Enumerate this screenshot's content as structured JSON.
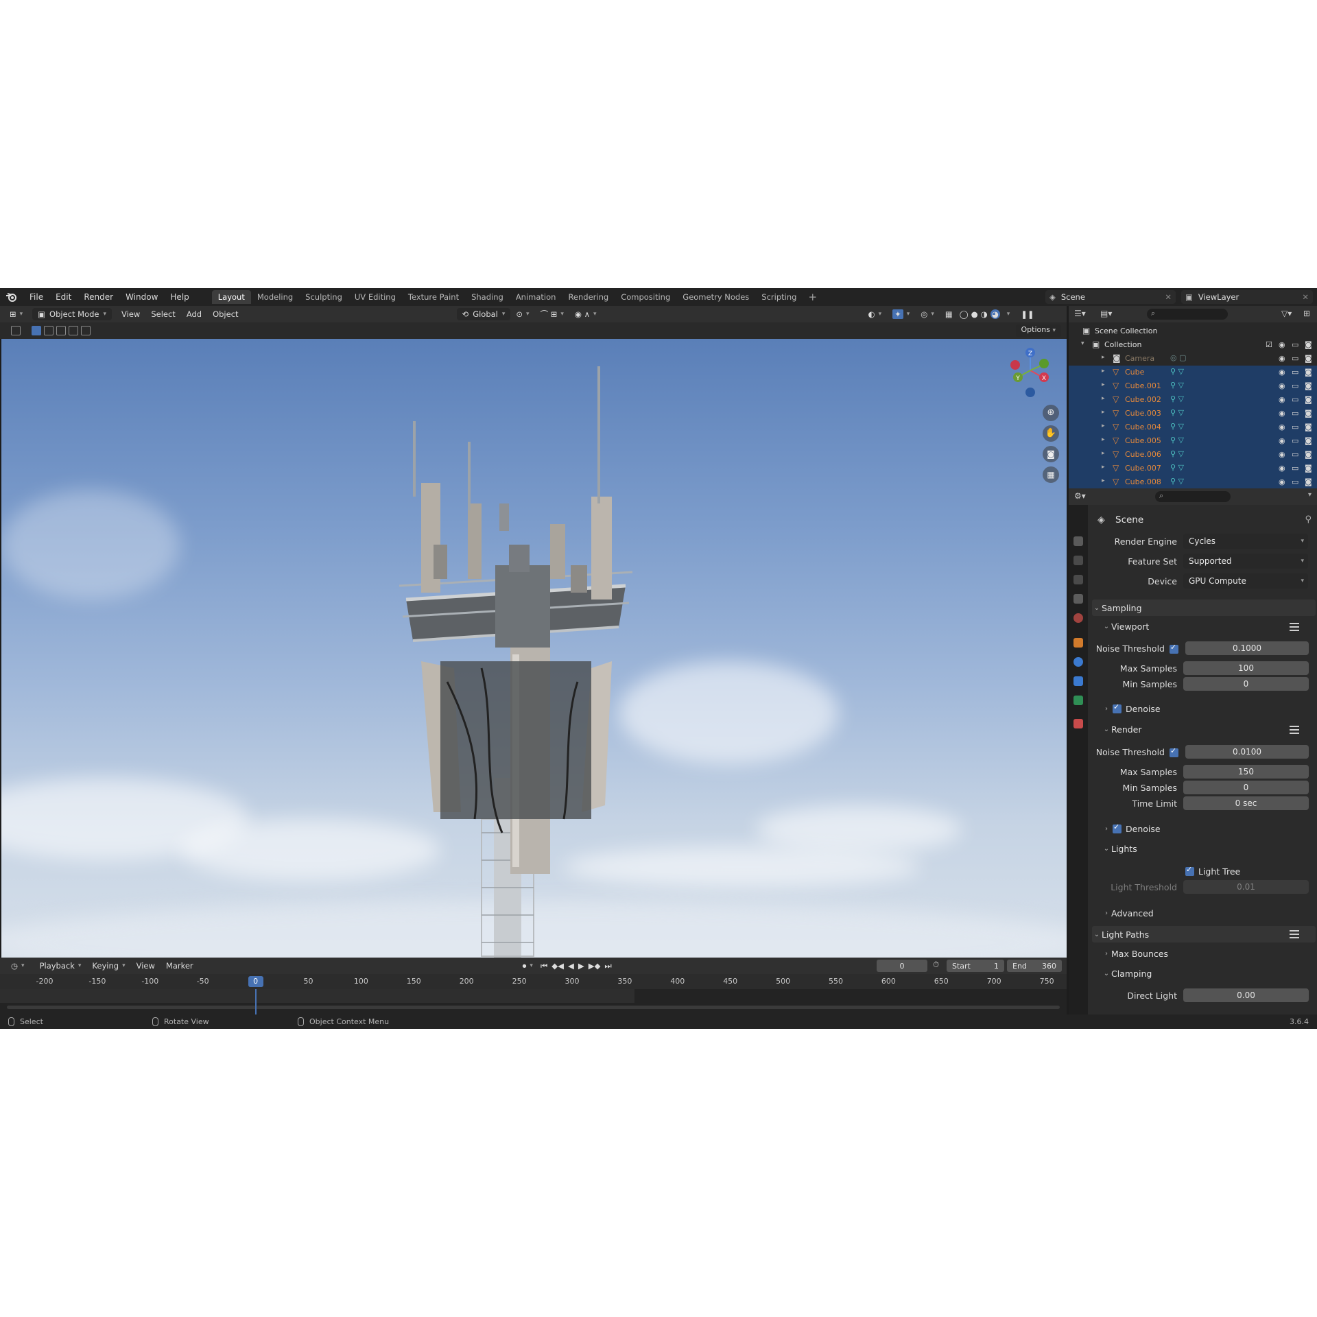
{
  "menu": [
    "File",
    "Edit",
    "Render",
    "Window",
    "Help"
  ],
  "workspaces": [
    "Layout",
    "Modeling",
    "Sculpting",
    "UV Editing",
    "Texture Paint",
    "Shading",
    "Animation",
    "Rendering",
    "Compositing",
    "Geometry Nodes",
    "Scripting"
  ],
  "active_workspace": "Layout",
  "scene_name": "Scene",
  "view_layer": "ViewLayer",
  "header": {
    "mode": "Object Mode",
    "view": "View",
    "select": "Select",
    "add": "Add",
    "object": "Object",
    "orientation": "Global"
  },
  "options_label": "Options",
  "outliner": {
    "scene_collection": "Scene Collection",
    "collection": "Collection",
    "objects": [
      "Camera",
      "Cube",
      "Cube.001",
      "Cube.002",
      "Cube.003",
      "Cube.004",
      "Cube.005",
      "Cube.006",
      "Cube.007",
      "Cube.008"
    ]
  },
  "properties": {
    "title": "Scene",
    "render_engine_label": "Render Engine",
    "render_engine": "Cycles",
    "feature_set_label": "Feature Set",
    "feature_set": "Supported",
    "device_label": "Device",
    "device": "GPU Compute",
    "sampling": "Sampling",
    "viewport": "Viewport",
    "noise_threshold_label": "Noise Threshold",
    "viewport_noise_threshold": "0.1000",
    "max_samples_label": "Max Samples",
    "viewport_max_samples": "100",
    "min_samples_label": "Min Samples",
    "viewport_min_samples": "0",
    "denoise": "Denoise",
    "render": "Render",
    "render_noise_threshold": "0.0100",
    "render_max_samples": "150",
    "render_min_samples": "0",
    "time_limit_label": "Time Limit",
    "time_limit": "0 sec",
    "lights": "Lights",
    "light_tree": "Light Tree",
    "light_threshold_label": "Light Threshold",
    "light_threshold": "0.01",
    "advanced": "Advanced",
    "light_paths": "Light Paths",
    "max_bounces": "Max Bounces",
    "clamping": "Clamping",
    "direct_light_label": "Direct Light",
    "direct_light": "0.00"
  },
  "timeline": {
    "playback": "Playback",
    "keying": "Keying",
    "view": "View",
    "marker": "Marker",
    "current_frame": "0",
    "start_label": "Start",
    "start": "1",
    "end_label": "End",
    "end": "360",
    "ticks": [
      "-200",
      "-150",
      "-100",
      "-50",
      "0",
      "50",
      "100",
      "150",
      "200",
      "250",
      "300",
      "350",
      "400",
      "450",
      "500",
      "550",
      "600",
      "650",
      "700",
      "750"
    ]
  },
  "status": {
    "select": "Select",
    "rotate": "Rotate View",
    "context": "Object Context Menu",
    "version": "3.6.4"
  },
  "gizmo_axes": {
    "z": "Z",
    "y": "Y",
    "x": "X"
  }
}
